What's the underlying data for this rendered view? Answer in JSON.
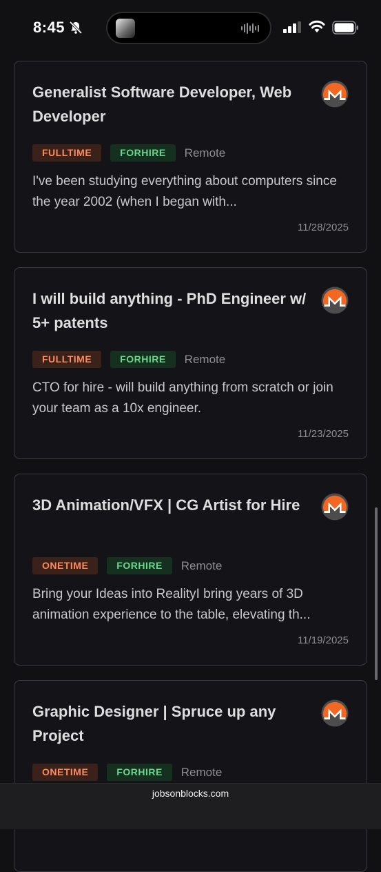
{
  "status_bar": {
    "time": "8:45"
  },
  "footer": {
    "url": "jobsonblocks.com"
  },
  "colors": {
    "background": "#111114",
    "card_border": "#3a3a40",
    "tag_orange": "#ff8a5b",
    "tag_green": "#69d98c",
    "monero_orange": "#f26822"
  },
  "listings": [
    {
      "title": "Generalist Software Developer, Web Developer",
      "tags": [
        "FULLTIME",
        "FORHIRE"
      ],
      "location": "Remote",
      "description": "I've been studying everything about computers since the year 2002 (when I began with...",
      "date": "11/28/2025",
      "icon": "monero-icon"
    },
    {
      "title": "I will build anything - PhD Engineer w/ 5+ patents",
      "tags": [
        "FULLTIME",
        "FORHIRE"
      ],
      "location": "Remote",
      "description": "CTO for hire - will build anything from scratch or join your team as a 10x engineer.",
      "date": "11/23/2025",
      "icon": "monero-icon"
    },
    {
      "title": "3D Animation/VFX | CG Artist for Hire",
      "tags": [
        "ONETIME",
        "FORHIRE"
      ],
      "location": "Remote",
      "description": "Bring your Ideas into RealityI bring years of 3D animation experience to the table, elevating th...",
      "date": "11/19/2025",
      "icon": "monero-icon"
    },
    {
      "title": "Graphic Designer | Spruce up any Project",
      "tags": [
        "ONETIME",
        "FORHIRE"
      ],
      "location": "Remote",
      "description": "",
      "date": "",
      "icon": "monero-icon"
    }
  ]
}
